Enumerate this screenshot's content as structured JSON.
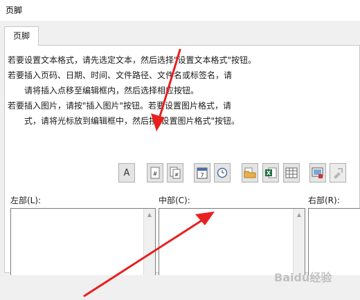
{
  "window": {
    "title": "页脚"
  },
  "tabs": [
    {
      "label": "页脚"
    }
  ],
  "instructions": [
    "若要设置文本格式，请先选定文本，然后选择\"设置文本格式\"按钮。",
    "若要插入页码、日期、时间、文件路径、文件名或标签名，请",
    "请将插入点移至编辑框内，然后选择相应按钮。",
    "若要插入图片，请按\"插入图片\"按钮。若要设置图片格式，请",
    "式，请将光标放到编辑框中，然后按\"设置图片格式\"按钮。"
  ],
  "toolbar": {
    "buttons": [
      {
        "name": "format-text",
        "glyph": "A"
      },
      {
        "name": "insert-page-number",
        "glyph": "#"
      },
      {
        "name": "insert-number-of-pages",
        "glyph": "#"
      },
      {
        "name": "insert-date",
        "glyph": "7"
      },
      {
        "name": "insert-time",
        "glyph": ""
      },
      {
        "name": "insert-file-path",
        "glyph": ""
      },
      {
        "name": "insert-file-name",
        "glyph": ""
      },
      {
        "name": "insert-sheet-name",
        "glyph": ""
      },
      {
        "name": "insert-picture",
        "glyph": ""
      },
      {
        "name": "format-picture",
        "glyph": ""
      }
    ]
  },
  "sections": {
    "left": {
      "label": "左部(L):"
    },
    "center": {
      "label": "中部(C):"
    },
    "right": {
      "label": "右部(R):"
    }
  },
  "icons": [
    "format-text-icon",
    "page-number-icon",
    "number-of-pages-icon",
    "date-icon",
    "time-icon",
    "file-path-icon",
    "file-name-icon",
    "sheet-name-icon",
    "picture-icon",
    "format-picture-icon",
    "scroll-up-icon",
    "scroll-down-icon"
  ],
  "colors": {
    "dialog_bg": "#f0f0f0",
    "panel_bg": "#ffffff",
    "annotation_arrow": "#e8201e",
    "excel_green": "#1e7145"
  },
  "watermark": "Baidu经验"
}
